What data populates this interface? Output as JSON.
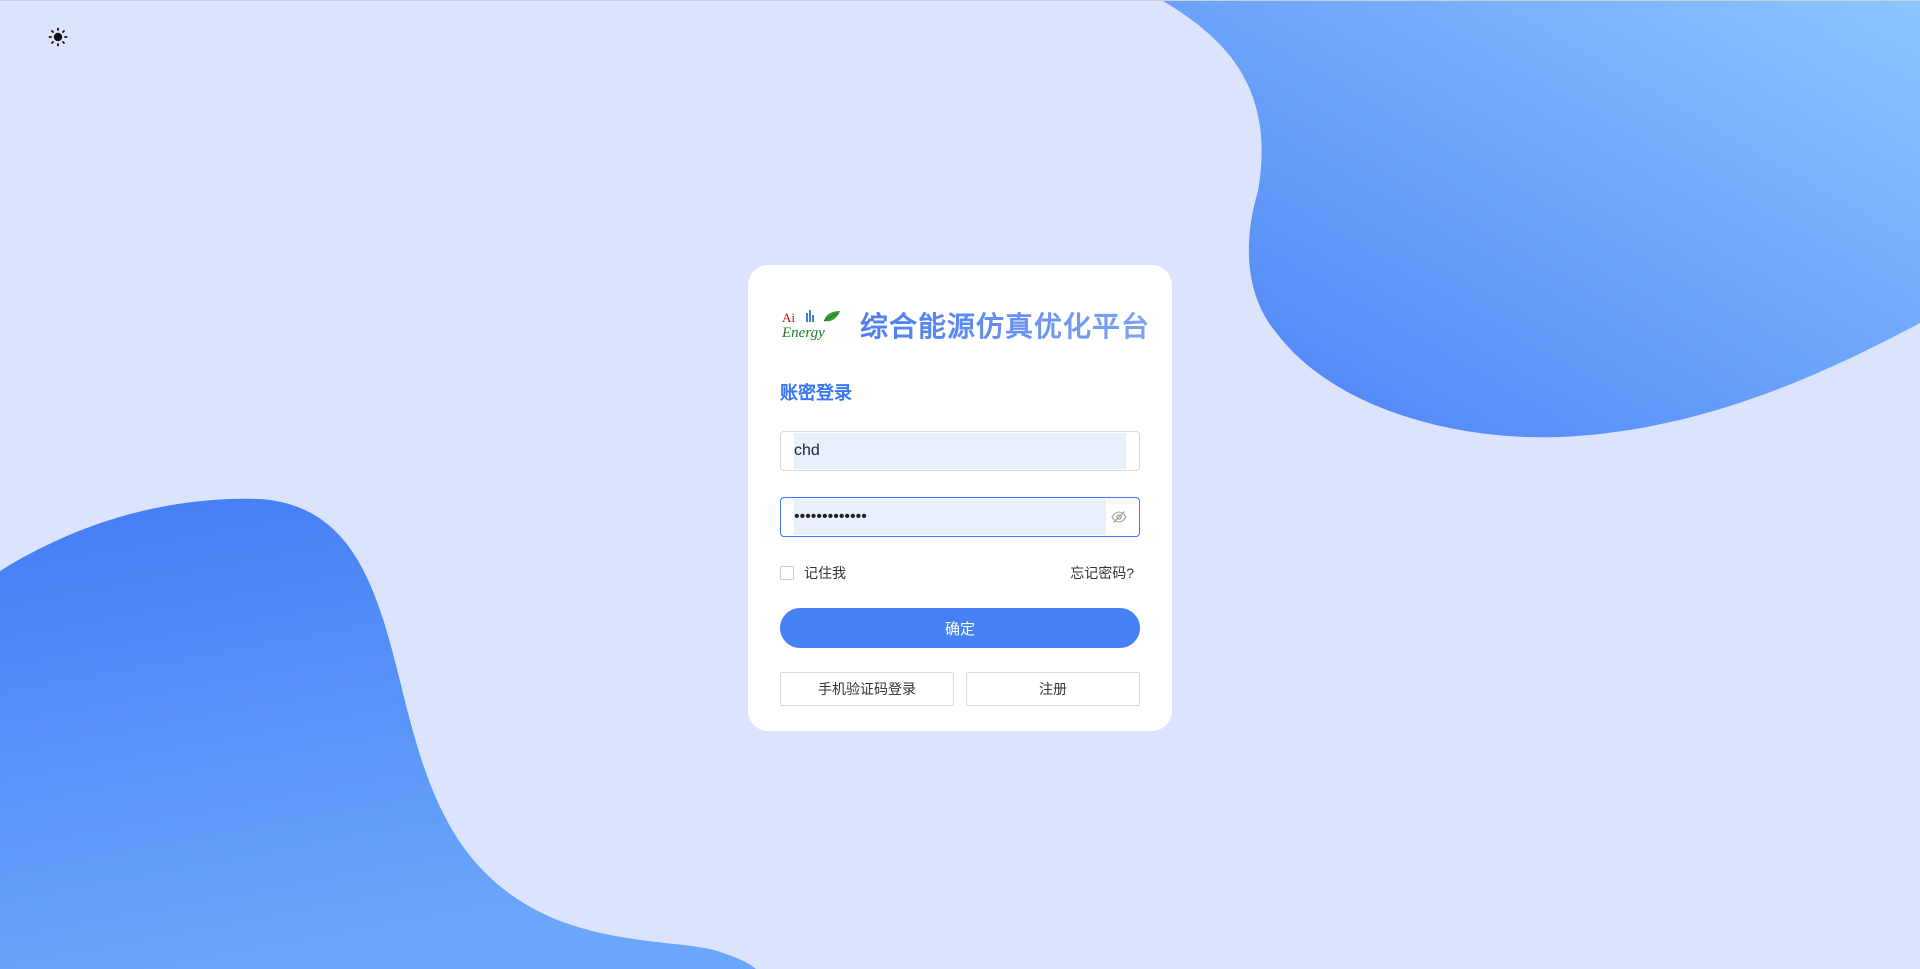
{
  "theme_toggle": {
    "icon": "sun-icon"
  },
  "brand": {
    "logo_text_top": "Ai",
    "logo_text_bottom": "Energy",
    "title": "综合能源仿真优化平台"
  },
  "login": {
    "tab_label": "账密登录",
    "username_value": "chd",
    "password_value": "•••••••••••••",
    "password_toggle_icon": "eye-hidden-icon",
    "remember_label": "记住我",
    "forgot_label": "忘记密码?",
    "submit_label": "确定",
    "sms_login_label": "手机验证码登录",
    "register_label": "注册"
  },
  "colors": {
    "background": "#dce3fd",
    "accent": "#4580f5",
    "blob_start": "#4a7ff5",
    "blob_end": "#8cc5ff"
  }
}
